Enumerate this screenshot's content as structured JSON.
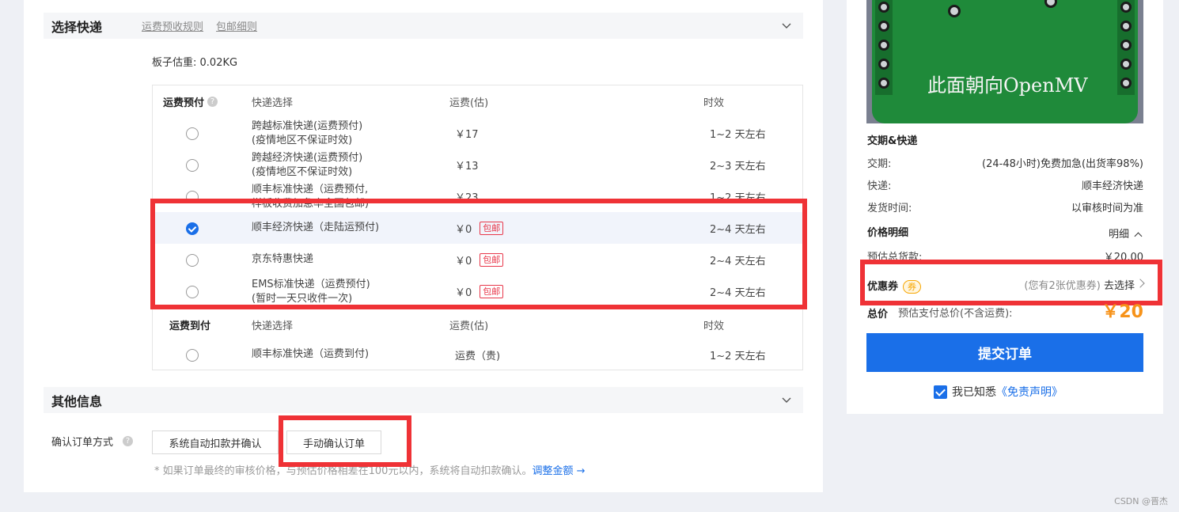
{
  "shipping_section": {
    "title": "选择快递",
    "link_prepay_rules": "运费预收规则",
    "link_free_shipping": "包邮细则",
    "weight_label": "板子估重:",
    "weight_value": "0.02KG"
  },
  "prepaid_header": {
    "type": "运费预付",
    "help": "?",
    "col_courier": "快递选择",
    "col_fee": "运费(估)",
    "col_time": "时效"
  },
  "prepaid_rows": [
    {
      "name_line1": "跨越标准快递(运费预付)",
      "name_line2": "(疫情地区不保证时效)",
      "fee": "￥17",
      "tag": "",
      "time": "1~2 天左右",
      "selected": false
    },
    {
      "name_line1": "跨越经济快递(运费预付)",
      "name_line2": "(疫情地区不保证时效)",
      "fee": "￥13",
      "tag": "",
      "time": "2~3 天左右",
      "selected": false
    },
    {
      "name_line1": "顺丰标准快递（运费预付,",
      "name_line2": "样板收费加急率全国包邮)",
      "fee": "￥23",
      "tag": "",
      "time": "1~2 天左右",
      "selected": false
    },
    {
      "name_line1": "顺丰经济快递（走陆运预付)",
      "name_line2": "",
      "fee": "￥0",
      "tag": "包邮",
      "time": "2~4 天左右",
      "selected": true
    },
    {
      "name_line1": "京东特惠快递",
      "name_line2": "",
      "fee": "￥0",
      "tag": "包邮",
      "time": "2~4 天左右",
      "selected": false
    },
    {
      "name_line1": "EMS标准快递（运费预付)",
      "name_line2": "(暂时一天只收件一次)",
      "fee": "￥0",
      "tag": "包邮",
      "time": "2~4 天左右",
      "selected": false
    }
  ],
  "cod_header": {
    "type": "运费到付",
    "col_courier": "快递选择",
    "col_fee": "运费(估)",
    "col_time": "时效"
  },
  "cod_rows": [
    {
      "name_line1": "顺丰标准快递（运费到付)",
      "fee": "运费（贵)",
      "time": "1~2 天左右",
      "selected": false
    }
  ],
  "other_section": {
    "title": "其他信息",
    "confirm_label": "确认订单方式",
    "help": "?",
    "option_auto": "系统自动扣款并确认",
    "option_manual": "手动确认订单",
    "note": "* 如果订单最终的审核价格，与预估价格相差在100元以内，系统将自动扣款确认。",
    "note_link": "调整金额 →"
  },
  "side": {
    "board_text": "此面朝向OpenMV",
    "delivery_title": "交期&快递",
    "lead_time_label": "交期:",
    "lead_time_value": "(24-48小时)免费加急(出货率98%)",
    "courier_label": "快递:",
    "courier_value": "顺丰经济快递",
    "ship_time_label": "发货时间:",
    "ship_time_value": "以审核时间为准",
    "price_title": "价格明细",
    "price_toggle": "明细",
    "estimated_label": "预估总货款:",
    "estimated_value": "￥20.00",
    "coupon_label": "优惠券",
    "coupon_badge": "券",
    "coupon_hint": "(您有2张优惠券)",
    "coupon_action": "去选择",
    "total_label": "总价",
    "total_sub": "预估支付总价(不含运费):",
    "total_value": "￥20",
    "submit_label": "提交订单",
    "agree_text": "我已知悉",
    "agree_link": "《免责声明》"
  },
  "watermark": "CSDN @晋杰",
  "colors": {
    "accent": "#1a6fe8",
    "highlight_red": "#ef3236",
    "price_orange": "#f7931a",
    "tag_red": "#e8384b"
  }
}
